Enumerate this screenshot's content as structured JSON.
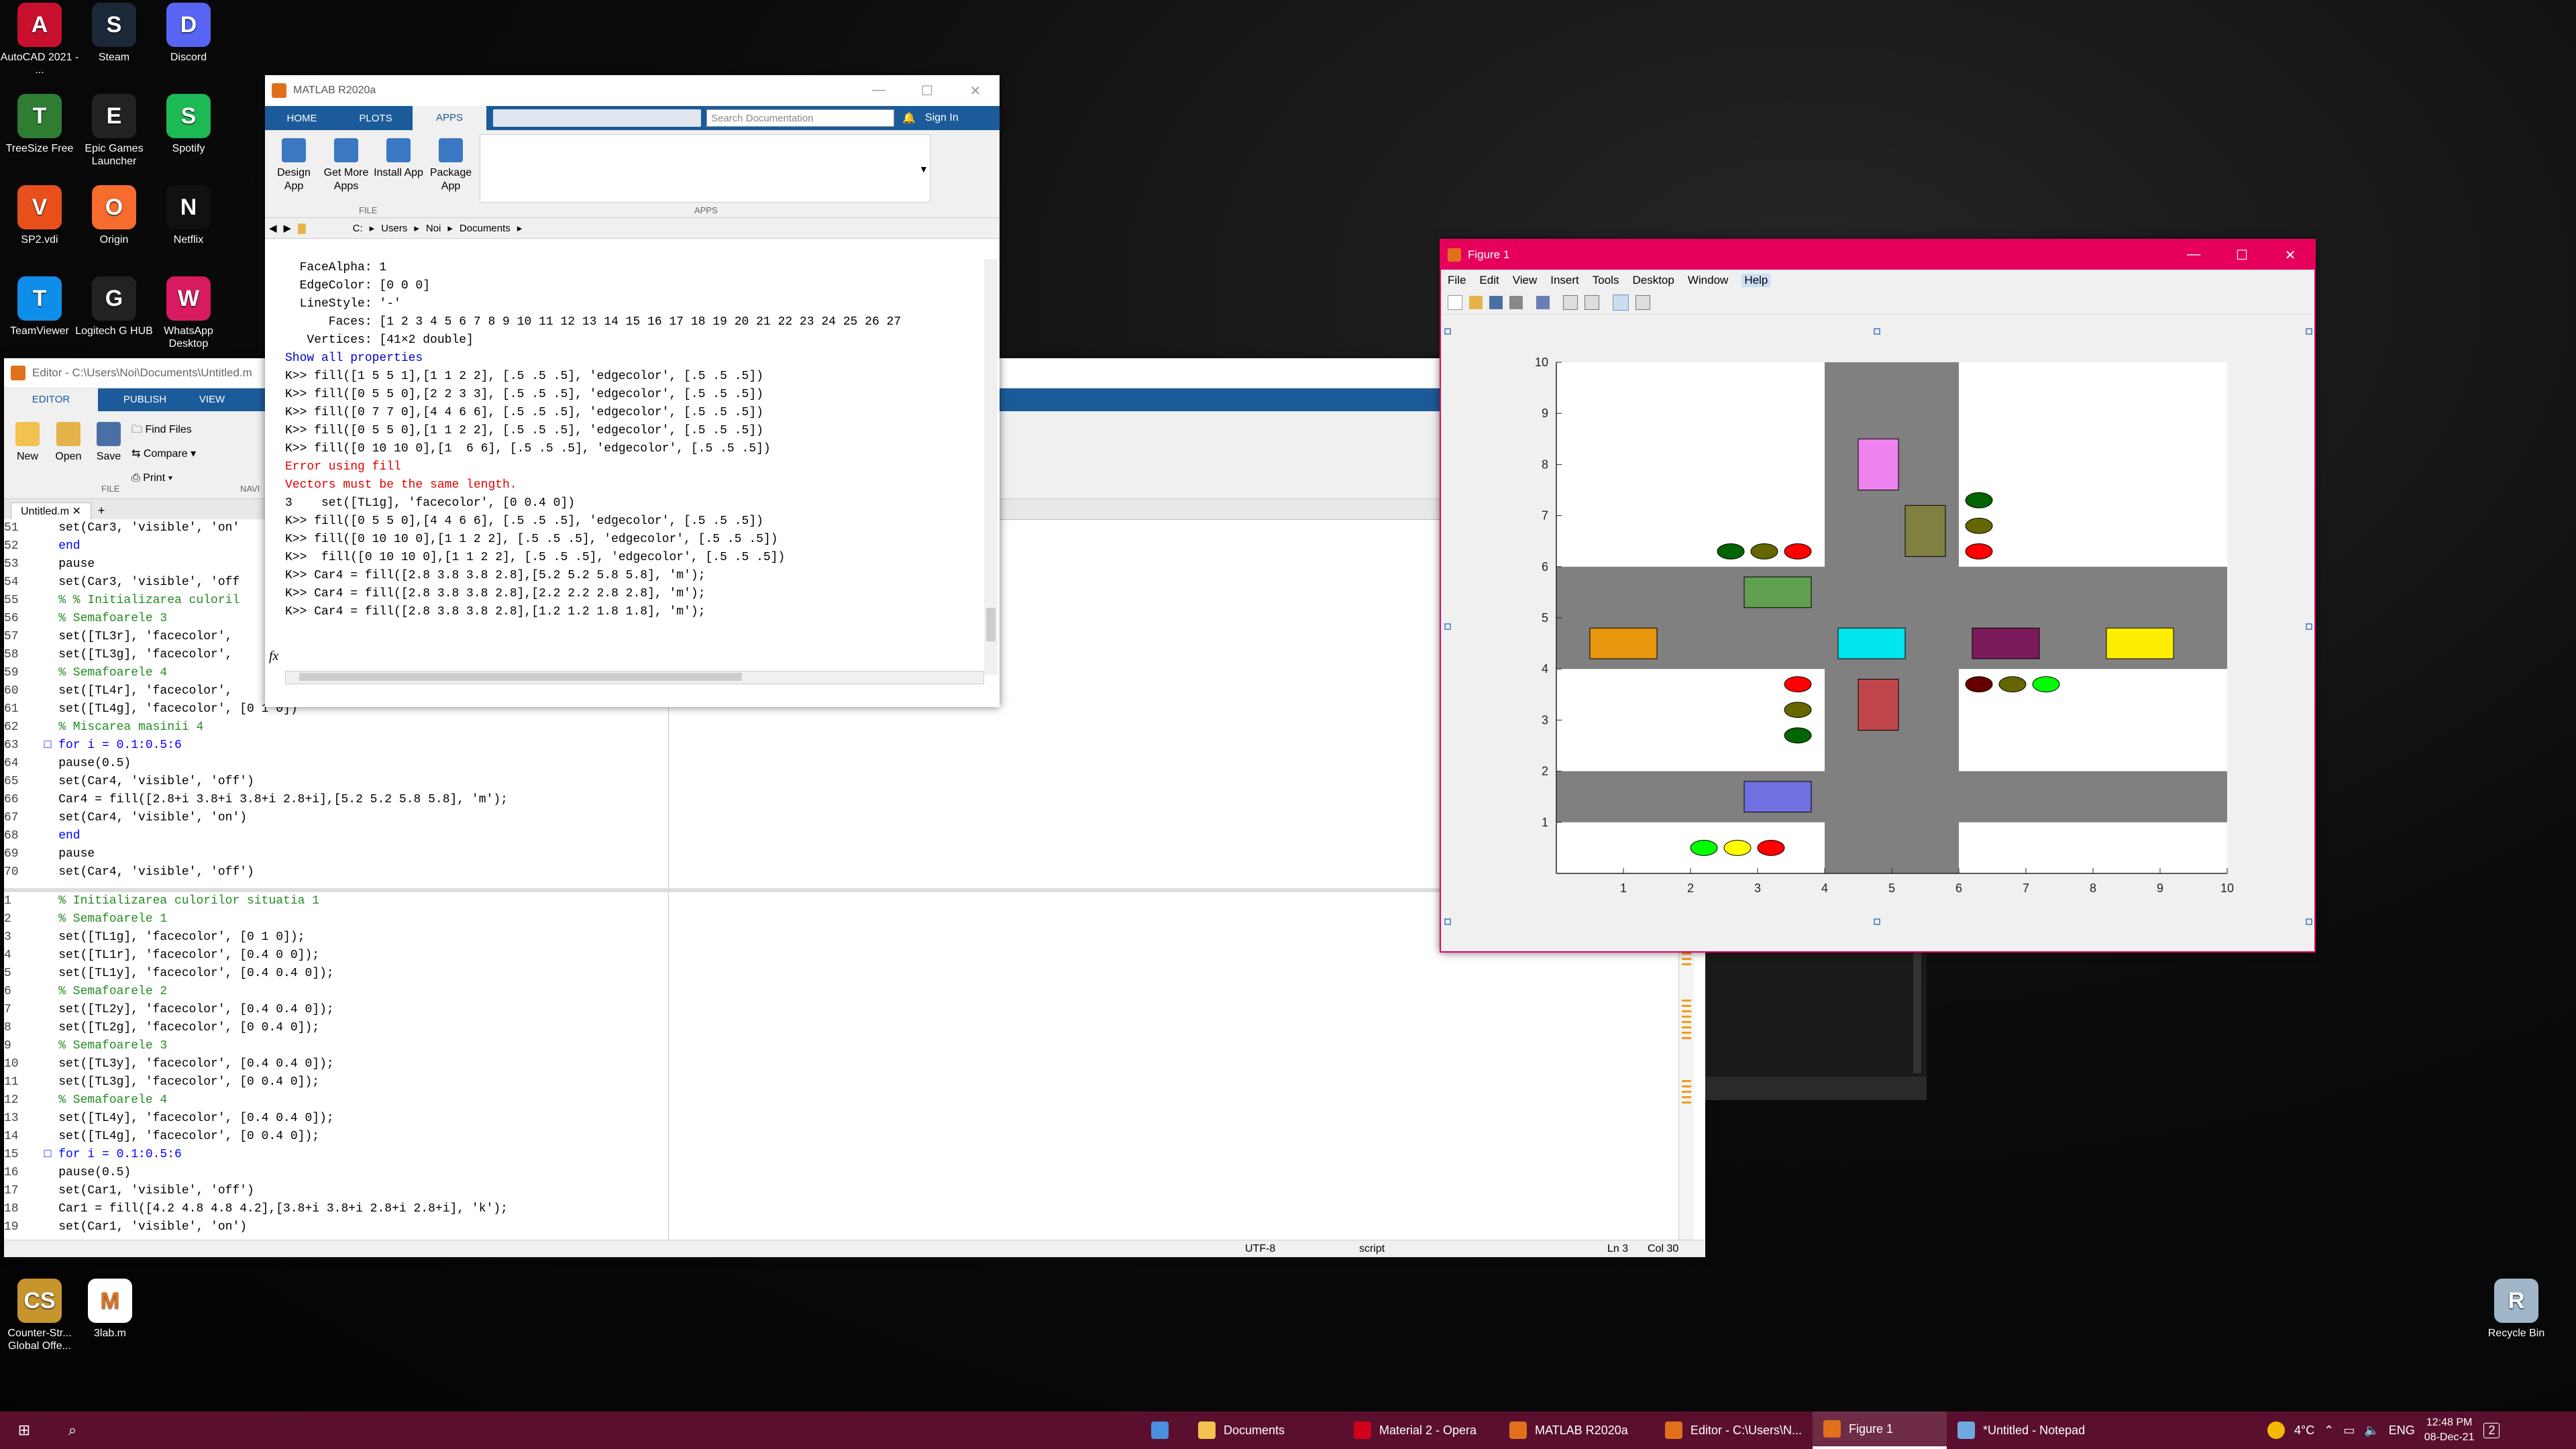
{
  "desktop": {
    "icons": [
      {
        "label": "AutoCAD 2021 - ...",
        "color": "#c8102e",
        "glyph": "A"
      },
      {
        "label": "Steam",
        "color": "#1b2838",
        "glyph": "S"
      },
      {
        "label": "Discord",
        "color": "#5865f2",
        "glyph": "D"
      },
      {
        "label": "TreeSize Free",
        "color": "#2e7d32",
        "glyph": "T"
      },
      {
        "label": "Epic Games Launcher",
        "color": "#222222",
        "glyph": "E"
      },
      {
        "label": "Spotify",
        "color": "#1db954",
        "glyph": "S"
      },
      {
        "label": "SP2.vdi",
        "color": "#e8501b",
        "glyph": "V"
      },
      {
        "label": "Origin",
        "color": "#f56c2d",
        "glyph": "O"
      },
      {
        "label": "Netflix",
        "color": "#111111",
        "glyph": "N"
      },
      {
        "label": "TeamViewer",
        "color": "#0e8ee9",
        "glyph": "T"
      },
      {
        "label": "Logitech G HUB",
        "color": "#222222",
        "glyph": "G"
      },
      {
        "label": "WhatsApp Desktop",
        "color": "#d81b60",
        "glyph": "W"
      },
      {
        "label": "Counter-Str... Global Offe...",
        "color": "#c7952d",
        "glyph": "CS"
      },
      {
        "label": "3lab.m",
        "color": "#ffffff",
        "glyph": "M"
      },
      {
        "label": "Recycle Bin",
        "color": "#9fb6c9",
        "glyph": "R"
      }
    ]
  },
  "matlab": {
    "title": "MATLAB R2020a",
    "tabs": [
      "HOME",
      "PLOTS",
      "APPS"
    ],
    "search_placeholder": "Search Documentation",
    "sign_in": "Sign In",
    "apps_buttons": [
      "Design App",
      "Get More Apps",
      "Install App",
      "Package App"
    ],
    "section_file": "FILE",
    "section_apps": "APPS",
    "path": [
      "C:",
      "Users",
      "Noi",
      "Documents"
    ],
    "fx": "fx",
    "cw_lines": [
      "  FaceAlpha: 1",
      "  EdgeColor: [0 0 0]",
      "  LineStyle: '-'",
      "      Faces: [1 2 3 4 5 6 7 8 9 10 11 12 13 14 15 16 17 18 19 20 21 22 23 24 25 26 27",
      "   Vertices: [41×2 double]",
      "",
      "Show all properties",
      "",
      "K>> fill([1 5 5 1],[1 1 2 2], [.5 .5 .5], 'edgecolor', [.5 .5 .5])",
      "K>> fill([0 5 5 0],[2 2 3 3], [.5 .5 .5], 'edgecolor', [.5 .5 .5])",
      "K>> fill([0 7 7 0],[4 4 6 6], [.5 .5 .5], 'edgecolor', [.5 .5 .5])",
      "K>> fill([0 5 5 0],[1 1 2 2], [.5 .5 .5], 'edgecolor', [.5 .5 .5])",
      "K>> fill([0 10 10 0],[1  6 6], [.5 .5 .5], 'edgecolor', [.5 .5 .5])",
      "Error using fill",
      "Vectors must be the same length.",
      "",
      "3    set([TL1g], 'facecolor', [0 0.4 0])",
      "K>> fill([0 5 5 0],[4 4 6 6], [.5 .5 .5], 'edgecolor', [.5 .5 .5])",
      "K>> fill([0 10 10 0],[1 1 2 2], [.5 .5 .5], 'edgecolor', [.5 .5 .5])",
      "K>>  fill([0 10 10 0],[1 1 2 2], [.5 .5 .5], 'edgecolor', [.5 .5 .5])",
      "K>> Car4 = fill([2.8 3.8 3.8 2.8],[5.2 5.2 5.8 5.8], 'm');",
      "K>> Car4 = fill([2.8 3.8 3.8 2.8],[2.2 2.2 2.8 2.8], 'm');",
      "K>> Car4 = fill([2.8 3.8 3.8 2.8],[1.2 1.2 1.8 1.8], 'm');"
    ]
  },
  "editor": {
    "title": "Editor - C:\\Users\\Noi\\Documents\\Untitled.m",
    "tabs": [
      "EDITOR",
      "PUBLISH",
      "VIEW"
    ],
    "buttons": {
      "new": "New",
      "open": "Open",
      "save": "Save",
      "find_files": "Find Files",
      "compare": "Compare",
      "print": "Print",
      "section_file": "FILE",
      "section_navi": "NAVI"
    },
    "file_tab": "Untitled.m",
    "top_lines": [
      {
        "n": "51",
        "t": "    set(Car3, 'visible', 'on'"
      },
      {
        "n": "52",
        "t": "    end"
      },
      {
        "n": "53",
        "t": "    pause"
      },
      {
        "n": "54",
        "t": "    set(Car3, 'visible', 'off"
      },
      {
        "n": "55",
        "t": "    % % Initializarea culoril"
      },
      {
        "n": "56",
        "t": "    % Semafoarele 3"
      },
      {
        "n": "57",
        "t": "    set([TL3r], 'facecolor',"
      },
      {
        "n": "58",
        "t": "    set([TL3g], 'facecolor',"
      },
      {
        "n": "59",
        "t": "    % Semafoarele 4"
      },
      {
        "n": "60",
        "t": "    set([TL4r], 'facecolor',"
      },
      {
        "n": "61",
        "t": "    set([TL4g], 'facecolor', [0 1 0])"
      },
      {
        "n": "62",
        "t": "    % Miscarea masinii 4"
      },
      {
        "n": "63",
        "t": "  □ for i = 0.1:0.5:6"
      },
      {
        "n": "64",
        "t": "    pause(0.5)"
      },
      {
        "n": "65",
        "t": "    set(Car4, 'visible', 'off')"
      },
      {
        "n": "66",
        "t": "    Car4 = fill([2.8+i 3.8+i 3.8+i 2.8+i],[5.2 5.2 5.8 5.8], 'm');"
      },
      {
        "n": "67",
        "t": "    set(Car4, 'visible', 'on')"
      },
      {
        "n": "68",
        "t": "    end"
      },
      {
        "n": "69",
        "t": "    pause"
      },
      {
        "n": "70",
        "t": "    set(Car4, 'visible', 'off')"
      }
    ],
    "bottom_lines": [
      {
        "n": "1",
        "t": "    % Initializarea culorilor situatia 1"
      },
      {
        "n": "2",
        "t": "    % Semafoarele 1"
      },
      {
        "n": "3",
        "t": "    set([TL1g], 'facecolor', [0 1 0]);"
      },
      {
        "n": "4",
        "t": "    set([TL1r], 'facecolor', [0.4 0 0]);"
      },
      {
        "n": "5",
        "t": "    set([TL1y], 'facecolor', [0.4 0.4 0]);"
      },
      {
        "n": "6",
        "t": "    % Semafoarele 2"
      },
      {
        "n": "7",
        "t": "    set([TL2y], 'facecolor', [0.4 0.4 0]);"
      },
      {
        "n": "8",
        "t": "    set([TL2g], 'facecolor', [0 0.4 0]);"
      },
      {
        "n": "9",
        "t": "    % Semafoarele 3"
      },
      {
        "n": "10",
        "t": "    set([TL3y], 'facecolor', [0.4 0.4 0]);"
      },
      {
        "n": "11",
        "t": "    set([TL3g], 'facecolor', [0 0.4 0]);"
      },
      {
        "n": "12",
        "t": "    % Semafoarele 4"
      },
      {
        "n": "13",
        "t": "    set([TL4y], 'facecolor', [0.4 0.4 0]);"
      },
      {
        "n": "14",
        "t": "    set([TL4g], 'facecolor', [0 0.4 0]);"
      },
      {
        "n": "15",
        "t": "  □ for i = 0.1:0.5:6"
      },
      {
        "n": "16",
        "t": "    pause(0.5)"
      },
      {
        "n": "17",
        "t": "    set(Car1, 'visible', 'off')"
      },
      {
        "n": "18",
        "t": "    Car1 = fill([4.2 4.8 4.8 4.2],[3.8+i 3.8+i 2.8+i 2.8+i], 'k');"
      },
      {
        "n": "19",
        "t": "    set(Car1, 'visible', 'on')"
      }
    ],
    "status": {
      "encoding": "UTF-8",
      "type": "script",
      "ln": "Ln  3",
      "col": "Col  30"
    }
  },
  "figure": {
    "title": "Figure 1",
    "menu": [
      "File",
      "Edit",
      "View",
      "Insert",
      "Tools",
      "Desktop",
      "Window",
      "Help"
    ],
    "x_ticks": [
      "1",
      "2",
      "3",
      "4",
      "5",
      "6",
      "7",
      "8",
      "9",
      "10"
    ],
    "y_ticks": [
      "1",
      "2",
      "3",
      "4",
      "5",
      "6",
      "7",
      "8",
      "9",
      "10"
    ]
  },
  "chart_data": {
    "type": "other",
    "xlim": [
      0,
      10
    ],
    "ylim": [
      0,
      10
    ],
    "x_ticks": [
      1,
      2,
      3,
      4,
      5,
      6,
      7,
      8,
      9,
      10
    ],
    "y_ticks": [
      1,
      2,
      3,
      4,
      5,
      6,
      7,
      8,
      9,
      10
    ],
    "grid": false,
    "roads": [
      {
        "x": [
          0,
          10
        ],
        "y": [
          4,
          6
        ]
      },
      {
        "x": [
          0,
          10
        ],
        "y": [
          1,
          2
        ]
      },
      {
        "x": [
          4,
          6
        ],
        "y": [
          0,
          10
        ]
      }
    ],
    "road_color": "#808080",
    "cars": [
      {
        "x": [
          4.5,
          5.1
        ],
        "y": [
          7.5,
          8.5
        ],
        "color": "#ee82ee"
      },
      {
        "x": [
          5.2,
          5.8
        ],
        "y": [
          6.2,
          7.2
        ],
        "color": "#808040"
      },
      {
        "x": [
          2.8,
          3.8
        ],
        "y": [
          5.2,
          5.8
        ],
        "color": "#60a050"
      },
      {
        "x": [
          0.5,
          1.5
        ],
        "y": [
          4.2,
          4.8
        ],
        "color": "#e8960e"
      },
      {
        "x": [
          4.2,
          5.2
        ],
        "y": [
          4.2,
          4.8
        ],
        "color": "#00e5ee"
      },
      {
        "x": [
          6.2,
          7.2
        ],
        "y": [
          4.2,
          4.8
        ],
        "color": "#7a1a5a"
      },
      {
        "x": [
          8.2,
          9.2
        ],
        "y": [
          4.2,
          4.8
        ],
        "color": "#ffee00"
      },
      {
        "x": [
          4.5,
          5.1
        ],
        "y": [
          2.8,
          3.8
        ],
        "color": "#c0454a"
      },
      {
        "x": [
          2.8,
          3.8
        ],
        "y": [
          1.2,
          1.8
        ],
        "color": "#7070e0"
      }
    ],
    "lights": [
      {
        "x": 2.6,
        "y": 6.3,
        "color": "#006400"
      },
      {
        "x": 3.1,
        "y": 6.3,
        "color": "#666600"
      },
      {
        "x": 3.6,
        "y": 6.3,
        "color": "#ff0000"
      },
      {
        "x": 6.3,
        "y": 7.3,
        "color": "#006400"
      },
      {
        "x": 6.3,
        "y": 6.8,
        "color": "#666600"
      },
      {
        "x": 6.3,
        "y": 6.3,
        "color": "#ff0000"
      },
      {
        "x": 3.6,
        "y": 3.7,
        "color": "#ff0000"
      },
      {
        "x": 3.6,
        "y": 3.2,
        "color": "#666600"
      },
      {
        "x": 3.6,
        "y": 2.7,
        "color": "#006400"
      },
      {
        "x": 6.3,
        "y": 3.7,
        "color": "#660000"
      },
      {
        "x": 6.8,
        "y": 3.7,
        "color": "#666600"
      },
      {
        "x": 7.3,
        "y": 3.7,
        "color": "#00ff00"
      },
      {
        "x": 2.2,
        "y": 0.5,
        "color": "#00ff00"
      },
      {
        "x": 2.7,
        "y": 0.5,
        "color": "#ffff00"
      },
      {
        "x": 3.2,
        "y": 0.5,
        "color": "#ff0000"
      }
    ]
  },
  "taskbar": {
    "items": [
      {
        "label": "Documents",
        "color": "#f2c14e"
      },
      {
        "label": "Material 2 - Opera",
        "color": "#d0021b"
      },
      {
        "label": "MATLAB R2020a",
        "color": "#e0701e"
      },
      {
        "label": "Editor - C:\\Users\\N...",
        "color": "#e0701e"
      },
      {
        "label": "Figure 1",
        "color": "#e0701e"
      },
      {
        "label": "*Untitled - Notepad",
        "color": "#6fa8dc"
      }
    ],
    "weather": "4°C",
    "lang": "ENG",
    "time": "12:48 PM",
    "date": "08-Dec-21",
    "notif": "2"
  }
}
